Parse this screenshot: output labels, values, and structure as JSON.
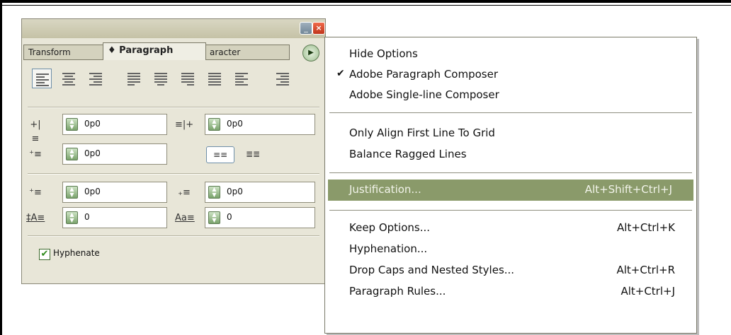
{
  "palette": {
    "tabs": [
      "Transform",
      "♦ Paragraph",
      "aracter"
    ],
    "fields": [
      {
        "name": "left-indent",
        "value": "0p0"
      },
      {
        "name": "right-indent",
        "value": "0p0"
      },
      {
        "name": "first-line-indent",
        "value": "0p0"
      },
      {
        "name": "space-before",
        "value": "0p0"
      },
      {
        "name": "space-after",
        "value": "0p0"
      },
      {
        "name": "drop-cap-lines",
        "value": "0"
      },
      {
        "name": "drop-cap-chars",
        "value": "0"
      }
    ],
    "hyphenate_label": "Hyphenate",
    "hyphenate_checked": true
  },
  "menu": {
    "items": [
      {
        "label": "Hide Options",
        "shortcut": ""
      },
      {
        "label": "Adobe Paragraph Composer",
        "shortcut": "",
        "checked": true
      },
      {
        "label": "Adobe Single-line Composer",
        "shortcut": ""
      },
      {
        "label": "Only Align First Line To Grid",
        "shortcut": ""
      },
      {
        "label": "Balance Ragged Lines",
        "shortcut": ""
      },
      {
        "label": "Justification...",
        "shortcut": "Alt+Shift+Ctrl+J",
        "highlighted": true
      },
      {
        "label": "Keep Options...",
        "shortcut": "Alt+Ctrl+K"
      },
      {
        "label": "Hyphenation...",
        "shortcut": ""
      },
      {
        "label": "Drop Caps and Nested Styles...",
        "shortcut": "Alt+Ctrl+R"
      },
      {
        "label": "Paragraph Rules...",
        "shortcut": "Alt+Ctrl+J"
      }
    ],
    "check_glyph": "✔"
  },
  "colors": {
    "highlight": "#8a9a6a",
    "palette_bg": "#e8e6d8"
  }
}
